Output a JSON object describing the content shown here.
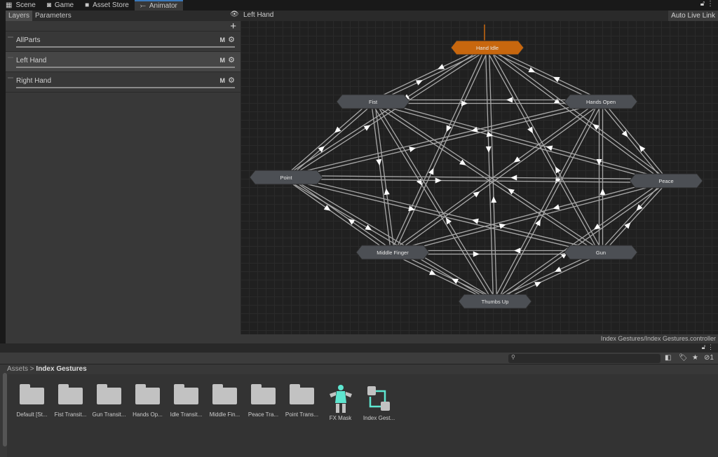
{
  "tabs": [
    {
      "label": "Scene",
      "icon": "grid-icon"
    },
    {
      "label": "Game",
      "icon": "gamepad-icon"
    },
    {
      "label": "Asset Store",
      "icon": "bag-icon"
    },
    {
      "label": "Animator",
      "icon": "animator-icon",
      "active": true
    }
  ],
  "animator": {
    "left_tabs": [
      "Layers",
      "Parameters"
    ],
    "add_label": "+",
    "layers": [
      {
        "name": "AllParts",
        "m": "M"
      },
      {
        "name": "Left Hand",
        "m": "M",
        "selected": true
      },
      {
        "name": "Right Hand",
        "m": "M"
      }
    ],
    "breadcrumb": "Left Hand",
    "live_link": "Auto Live Link",
    "status_path": "Index Gestures/Index Gestures.controller",
    "states": [
      "Hand Idle",
      "Fist",
      "Hands Open",
      "Point",
      "Peace",
      "Middle Finger",
      "Gun",
      "Thumbs Up"
    ],
    "default_state": "Hand Idle",
    "colors": {
      "default_state": "#c8670e",
      "state": "#4c4f54"
    }
  },
  "project": {
    "path": [
      "Assets",
      "Index Gestures"
    ],
    "search_placeholder": "",
    "hidden_count": "1",
    "assets": [
      {
        "name": "Default [St...",
        "type": "folder"
      },
      {
        "name": "Fist Transit...",
        "type": "folder"
      },
      {
        "name": "Gun Transit...",
        "type": "folder"
      },
      {
        "name": "Hands Op...",
        "type": "folder"
      },
      {
        "name": "Idle Transit...",
        "type": "folder"
      },
      {
        "name": "Middle Fin...",
        "type": "folder"
      },
      {
        "name": "Peace Tra...",
        "type": "folder"
      },
      {
        "name": "Point Trans...",
        "type": "folder"
      },
      {
        "name": "FX Mask",
        "type": "avatar-mask"
      },
      {
        "name": "Index Gest...",
        "type": "animator-controller"
      }
    ],
    "accent": "#5ee6d0"
  }
}
